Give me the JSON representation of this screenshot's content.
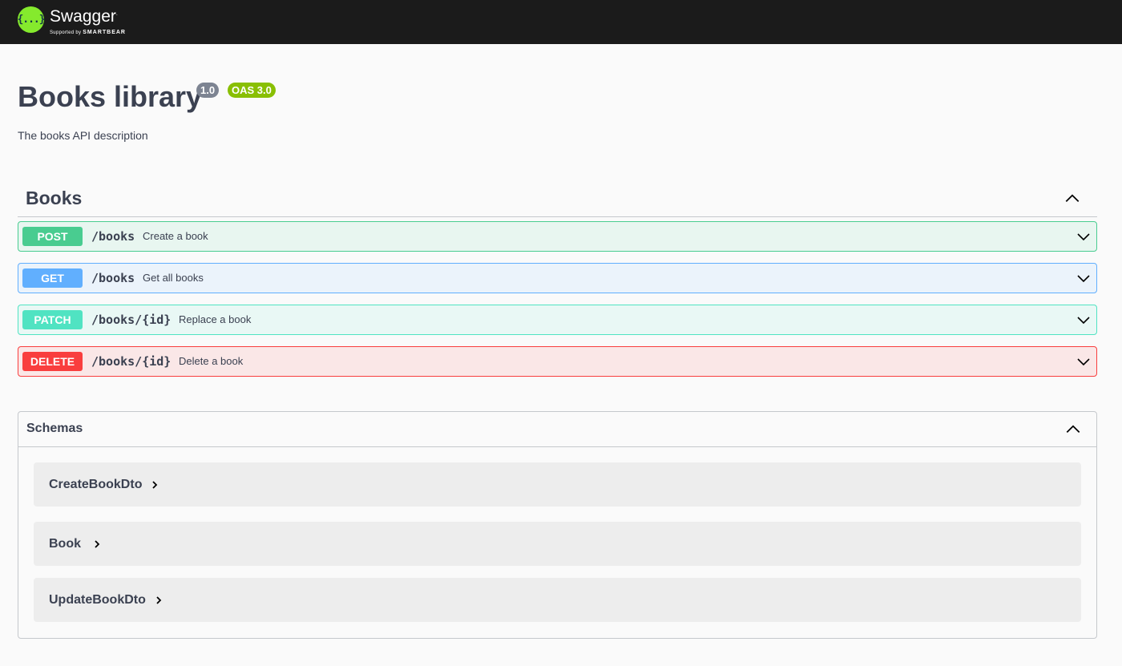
{
  "topbar": {
    "logo_glyph": "{...}",
    "brand": "Swagger",
    "brand_mark": ".",
    "supported_by": "Supported by",
    "smartbear": "SMARTBEAR",
    "logo_color": "#85ea2d"
  },
  "info": {
    "title": "Books library",
    "version": "1.0",
    "oas": "OAS 3.0",
    "description": "The books API description"
  },
  "tag": {
    "name": "Books",
    "icon": "chevron-up-icon"
  },
  "operations": [
    {
      "method": "POST",
      "path": "/books",
      "summary": "Create a book",
      "color": "#49cc90"
    },
    {
      "method": "GET",
      "path": "/books",
      "summary": "Get all books",
      "color": "#61affe"
    },
    {
      "method": "PATCH",
      "path": "/books/{id}",
      "summary": "Replace a book",
      "color": "#50e3c2"
    },
    {
      "method": "DELETE",
      "path": "/books/{id}",
      "summary": "Delete a book",
      "color": "#f93e3e"
    }
  ],
  "schemas": {
    "title": "Schemas",
    "models": [
      {
        "name": "CreateBookDto"
      },
      {
        "name": "Book"
      },
      {
        "name": "UpdateBookDto"
      }
    ]
  }
}
